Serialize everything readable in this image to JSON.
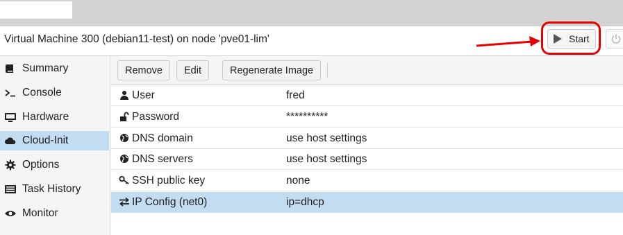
{
  "header": {
    "title": "Virtual Machine 300 (debian11-test) on node 'pve01-lim'",
    "start_label": "Start"
  },
  "sidebar": {
    "items": [
      {
        "label": "Summary",
        "icon": "book-icon"
      },
      {
        "label": "Console",
        "icon": "terminal-icon"
      },
      {
        "label": "Hardware",
        "icon": "monitor-icon"
      },
      {
        "label": "Cloud-Init",
        "icon": "cloud-icon",
        "active": true
      },
      {
        "label": "Options",
        "icon": "gear-icon"
      },
      {
        "label": "Task History",
        "icon": "list-icon"
      },
      {
        "label": "Monitor",
        "icon": "eye-icon"
      }
    ]
  },
  "toolbar": {
    "remove_label": "Remove",
    "edit_label": "Edit",
    "regenerate_label": "Regenerate Image"
  },
  "grid": {
    "rows": [
      {
        "key": "User",
        "value": "fred",
        "icon": "user-icon"
      },
      {
        "key": "Password",
        "value": "**********",
        "icon": "unlock-icon"
      },
      {
        "key": "DNS domain",
        "value": "use host settings",
        "icon": "globe-icon"
      },
      {
        "key": "DNS servers",
        "value": "use host settings",
        "icon": "globe-icon"
      },
      {
        "key": "SSH public key",
        "value": "none",
        "icon": "key-icon"
      },
      {
        "key": "IP Config (net0)",
        "value": "ip=dhcp",
        "icon": "exchange-icon",
        "selected": true
      }
    ]
  },
  "colors": {
    "selection": "#c2dcf2",
    "highlight_ring": "#e60000"
  }
}
